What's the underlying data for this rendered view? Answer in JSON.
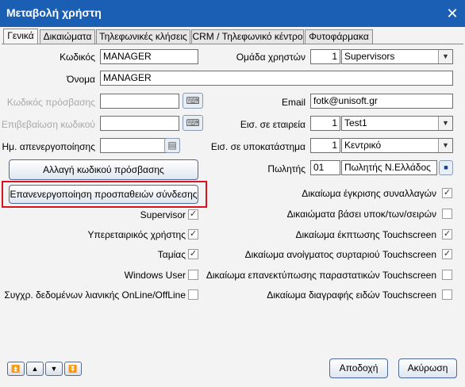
{
  "window": {
    "title": "Μεταβολή χρήστη",
    "close_glyph": "✕"
  },
  "tabs": [
    {
      "label": "Γενικά",
      "active": true
    },
    {
      "label": "Δικαιώματα",
      "active": false
    },
    {
      "label": "Τηλεφωνικές κλήσεις",
      "active": false
    },
    {
      "label": "CRM / Τηλεφωνικό κέντρο",
      "active": false
    },
    {
      "label": "Φυτοφάρμακα",
      "active": false
    }
  ],
  "left": {
    "code_label": "Κωδικός",
    "code_value": "MANAGER",
    "name_label": "Όνομα",
    "name_value": "MANAGER",
    "password_label": "Κωδικός πρόσβασης",
    "password_value": "",
    "confirm_label": "Επιβεβαίωση κωδικού",
    "confirm_value": "",
    "deactivation_label": "Ημ. απενεργοποίησης",
    "deactivation_value": "",
    "change_password_button": "Αλλαγή κωδικού πρόσβασης",
    "reactivate_button": "Επανενεργοποίηση προσπαθειών σύνδεσης"
  },
  "right": {
    "group_label": "Ομάδα χρηστών",
    "group_num": "1",
    "group_name": "Supervisors",
    "email_label": "Email",
    "email_value": "fotk@unisoft.gr",
    "company_label": "Εισ. σε εταιρεία",
    "company_num": "1",
    "company_name": "Test1",
    "branch_label": "Εισ. σε υποκατάστημα",
    "branch_num": "1",
    "branch_name": "Κεντρικό",
    "seller_label": "Πωλητής",
    "seller_code": "01",
    "seller_name": "Πωλητής Ν.Ελλάδος"
  },
  "left_checks": [
    {
      "label": "Supervisor",
      "checked": true
    },
    {
      "label": "Υπερεταιρικός χρήστης",
      "checked": true
    },
    {
      "label": "Ταμίας",
      "checked": true
    },
    {
      "label": "Windows User",
      "checked": false
    },
    {
      "label": "Συγχρ. δεδομένων λιανικής OnLine/OffLine",
      "checked": false
    }
  ],
  "right_checks": [
    {
      "label": "Δικαίωμα έγκρισης συναλλαγών",
      "checked": true
    },
    {
      "label": "Δικαιώματα βάσει υποκ/των/σειρών",
      "checked": false
    },
    {
      "label": "Δικαίωμα έκπτωσης Touchscreen",
      "checked": true
    },
    {
      "label": "Δικαίωμα ανοίγματος συρταριού Touchscreen",
      "checked": true
    },
    {
      "label": "Δικαίωμα επανεκτύπωσης παραστατικών Touchscreen",
      "checked": false
    },
    {
      "label": "Δικαίωμα διαγραφής ειδών Touchscreen",
      "checked": false
    }
  ],
  "footer": {
    "cancel_button": "Αποδοχή",
    "close_button": "Ακύρωση",
    "nav_first": "⏫",
    "nav_prev": "▲",
    "nav_next": "▼",
    "nav_last": "⏬"
  },
  "colors": {
    "titlebar": "#1a5fb4",
    "highlight": "#d9141e"
  }
}
